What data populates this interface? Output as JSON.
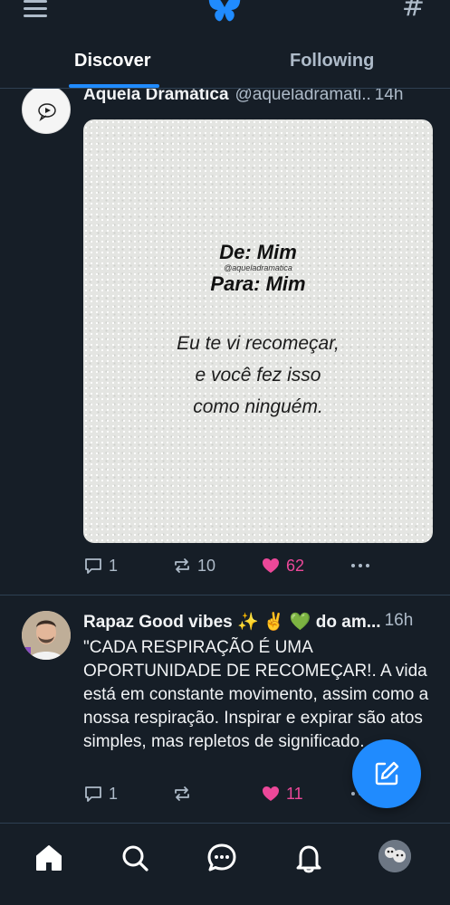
{
  "header": {
    "icons": {
      "menu": "hamburger-menu-icon",
      "logo": "butterfly-logo",
      "feeds": "hashtag-icon"
    },
    "tabs": [
      {
        "label": "Discover",
        "active": true
      },
      {
        "label": "Following",
        "active": false
      }
    ],
    "accent_color": "#208bfe"
  },
  "feed": [
    {
      "author": "Aquela Dramática",
      "handle": "@aqueladramati..",
      "time": "14h",
      "image": {
        "from": "De: Mim",
        "watermark": "@aqueladramatica",
        "to": "Para: Mim",
        "lines": [
          "Eu te vi recomeçar,",
          "e você fez isso",
          "como ninguém."
        ]
      },
      "stats": {
        "replies": "1",
        "reposts": "10",
        "likes": "62",
        "liked": true
      }
    },
    {
      "author": "Rapaz Good vibes ✨ ✌️ 💚 do am...",
      "time": "16h",
      "text": "\"CADA RESPIRAÇÃO É UMA OPORTUNIDADE DE RECOMEÇAR!. A vida está em constante movimento, assim como a nossa respiração. Inspirar e expirar são atos simples, mas repletos de significado.",
      "stats": {
        "replies": "1",
        "reposts": "",
        "likes": "11",
        "liked": true
      }
    }
  ],
  "colors": {
    "like": "#ec4899",
    "muted": "#aebbc9",
    "background": "#161e27"
  },
  "bottom_nav": [
    "home-icon",
    "search-icon",
    "chat-icon",
    "bell-icon",
    "profile-avatar"
  ]
}
